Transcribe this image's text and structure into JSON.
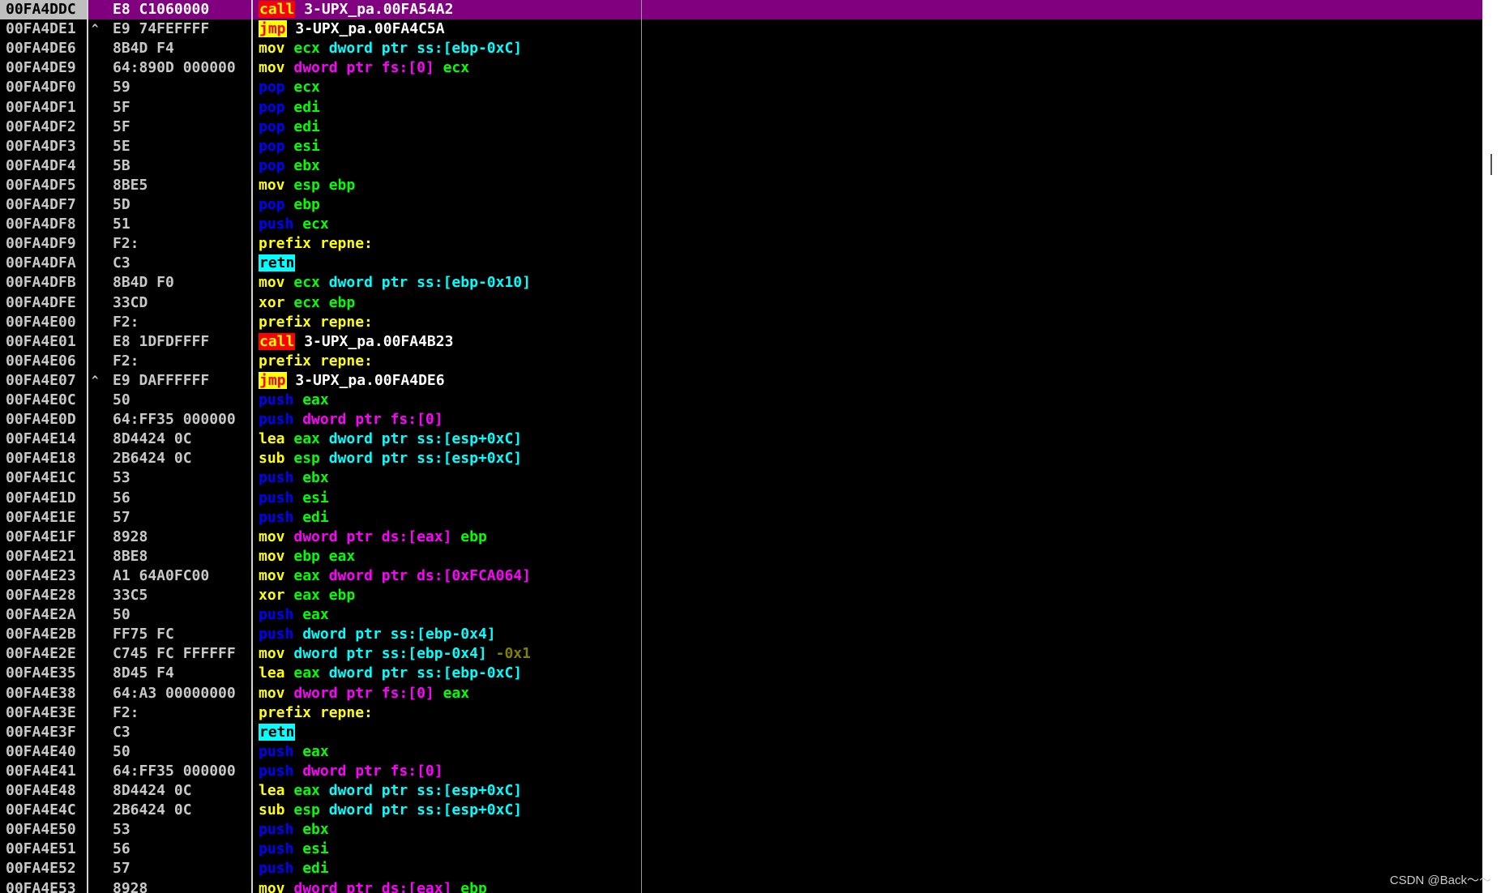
{
  "watermark": "CSDN @Back～～",
  "colors": {
    "selected_row": "#800080",
    "mnemonic": "#ffff00",
    "push_pop": "#0000ff",
    "register": "#00ff00",
    "memory_fs_ds": "#ff00ff",
    "stack_ss": "#00ffff",
    "negative_imm": "#808000",
    "call_highlight": "#ff0000",
    "jmp_highlight": "#ffff00",
    "retn_highlight": "#00ffff"
  },
  "rows": [
    {
      "addr": "00FA4DDC",
      "jmp": "",
      "hex": "E8 C1060000",
      "selected": true,
      "asm": [
        [
          "call",
          "call"
        ],
        [
          " ",
          ""
        ],
        [
          "3-UPX_pa.00FA54A2",
          "tgt"
        ]
      ]
    },
    {
      "addr": "00FA4DE1",
      "jmp": "^",
      "hex": "E9 74FEFFFF",
      "asm": [
        [
          "jmp",
          "jmp"
        ],
        [
          " ",
          ""
        ],
        [
          "3-UPX_pa.00FA4C5A",
          "tgt"
        ]
      ]
    },
    {
      "addr": "00FA4DE6",
      "jmp": "",
      "hex": "8B4D F4",
      "asm": [
        [
          "mov",
          "mn"
        ],
        [
          " ",
          ""
        ],
        [
          "ecx",
          "op"
        ],
        [
          ",",
          ""
        ],
        [
          "dword ptr ss:[ebp-0xC]",
          "ss"
        ]
      ]
    },
    {
      "addr": "00FA4DE9",
      "jmp": "",
      "hex": "64:890D 000000",
      "asm": [
        [
          "mov",
          "mn"
        ],
        [
          " ",
          ""
        ],
        [
          "dword ptr fs:[0]",
          "mem"
        ],
        [
          ",",
          ""
        ],
        [
          "ecx",
          "op"
        ]
      ]
    },
    {
      "addr": "00FA4DF0",
      "jmp": "",
      "hex": "59",
      "asm": [
        [
          "pop",
          "push"
        ],
        [
          " ",
          ""
        ],
        [
          "ecx",
          "op"
        ]
      ]
    },
    {
      "addr": "00FA4DF1",
      "jmp": "",
      "hex": "5F",
      "asm": [
        [
          "pop",
          "push"
        ],
        [
          " ",
          ""
        ],
        [
          "edi",
          "op"
        ]
      ]
    },
    {
      "addr": "00FA4DF2",
      "jmp": "",
      "hex": "5F",
      "asm": [
        [
          "pop",
          "push"
        ],
        [
          " ",
          ""
        ],
        [
          "edi",
          "op"
        ]
      ]
    },
    {
      "addr": "00FA4DF3",
      "jmp": "",
      "hex": "5E",
      "asm": [
        [
          "pop",
          "push"
        ],
        [
          " ",
          ""
        ],
        [
          "esi",
          "op"
        ]
      ]
    },
    {
      "addr": "00FA4DF4",
      "jmp": "",
      "hex": "5B",
      "asm": [
        [
          "pop",
          "push"
        ],
        [
          " ",
          ""
        ],
        [
          "ebx",
          "op"
        ]
      ]
    },
    {
      "addr": "00FA4DF5",
      "jmp": "",
      "hex": "8BE5",
      "asm": [
        [
          "mov",
          "mn"
        ],
        [
          " ",
          ""
        ],
        [
          "esp",
          "op"
        ],
        [
          ",",
          ""
        ],
        [
          "ebp",
          "op"
        ]
      ]
    },
    {
      "addr": "00FA4DF7",
      "jmp": "",
      "hex": "5D",
      "asm": [
        [
          "pop",
          "push"
        ],
        [
          " ",
          ""
        ],
        [
          "ebp",
          "op"
        ]
      ]
    },
    {
      "addr": "00FA4DF8",
      "jmp": "",
      "hex": "51",
      "asm": [
        [
          "push",
          "push"
        ],
        [
          " ",
          ""
        ],
        [
          "ecx",
          "op"
        ]
      ]
    },
    {
      "addr": "00FA4DF9",
      "jmp": "",
      "hex": "F2:",
      "asm": [
        [
          "prefix repne:",
          "mn"
        ]
      ]
    },
    {
      "addr": "00FA4DFA",
      "jmp": "",
      "hex": "C3",
      "asm": [
        [
          "retn",
          "retn"
        ]
      ]
    },
    {
      "addr": "00FA4DFB",
      "jmp": "",
      "hex": "8B4D F0",
      "asm": [
        [
          "mov",
          "mn"
        ],
        [
          " ",
          ""
        ],
        [
          "ecx",
          "op"
        ],
        [
          ",",
          ""
        ],
        [
          "dword ptr ss:[ebp-0x10]",
          "ss"
        ]
      ]
    },
    {
      "addr": "00FA4DFE",
      "jmp": "",
      "hex": "33CD",
      "asm": [
        [
          "xor",
          "mn"
        ],
        [
          " ",
          ""
        ],
        [
          "ecx",
          "op"
        ],
        [
          ",",
          ""
        ],
        [
          "ebp",
          "op"
        ]
      ]
    },
    {
      "addr": "00FA4E00",
      "jmp": "",
      "hex": "F2:",
      "asm": [
        [
          "prefix repne:",
          "mn"
        ]
      ]
    },
    {
      "addr": "00FA4E01",
      "jmp": "",
      "hex": "E8 1DFDFFFF",
      "asm": [
        [
          "call",
          "call"
        ],
        [
          " ",
          ""
        ],
        [
          "3-UPX_pa.00FA4B23",
          "tgt"
        ]
      ]
    },
    {
      "addr": "00FA4E06",
      "jmp": "",
      "hex": "F2:",
      "asm": [
        [
          "prefix repne:",
          "mn"
        ]
      ]
    },
    {
      "addr": "00FA4E07",
      "jmp": "^",
      "hex": "E9 DAFFFFFF",
      "asm": [
        [
          "jmp",
          "jmp"
        ],
        [
          " ",
          ""
        ],
        [
          "3-UPX_pa.00FA4DE6",
          "tgt"
        ]
      ]
    },
    {
      "addr": "00FA4E0C",
      "jmp": "",
      "hex": "50",
      "asm": [
        [
          "push",
          "push"
        ],
        [
          " ",
          ""
        ],
        [
          "eax",
          "op"
        ]
      ]
    },
    {
      "addr": "00FA4E0D",
      "jmp": "",
      "hex": "64:FF35 000000",
      "asm": [
        [
          "push",
          "push"
        ],
        [
          " ",
          ""
        ],
        [
          "dword ptr fs:[0]",
          "mem"
        ]
      ]
    },
    {
      "addr": "00FA4E14",
      "jmp": "",
      "hex": "8D4424 0C",
      "asm": [
        [
          "lea",
          "mn"
        ],
        [
          " ",
          ""
        ],
        [
          "eax",
          "op"
        ],
        [
          ",",
          ""
        ],
        [
          "dword ptr ss:[esp+0xC]",
          "ss"
        ]
      ]
    },
    {
      "addr": "00FA4E18",
      "jmp": "",
      "hex": "2B6424 0C",
      "asm": [
        [
          "sub",
          "mn"
        ],
        [
          " ",
          ""
        ],
        [
          "esp",
          "op"
        ],
        [
          ",",
          ""
        ],
        [
          "dword ptr ss:[esp+0xC]",
          "ss"
        ]
      ]
    },
    {
      "addr": "00FA4E1C",
      "jmp": "",
      "hex": "53",
      "asm": [
        [
          "push",
          "push"
        ],
        [
          " ",
          ""
        ],
        [
          "ebx",
          "op"
        ]
      ]
    },
    {
      "addr": "00FA4E1D",
      "jmp": "",
      "hex": "56",
      "asm": [
        [
          "push",
          "push"
        ],
        [
          " ",
          ""
        ],
        [
          "esi",
          "op"
        ]
      ]
    },
    {
      "addr": "00FA4E1E",
      "jmp": "",
      "hex": "57",
      "asm": [
        [
          "push",
          "push"
        ],
        [
          " ",
          ""
        ],
        [
          "edi",
          "op"
        ]
      ]
    },
    {
      "addr": "00FA4E1F",
      "jmp": "",
      "hex": "8928",
      "asm": [
        [
          "mov",
          "mn"
        ],
        [
          " ",
          ""
        ],
        [
          "dword ptr ds:[eax]",
          "mem"
        ],
        [
          ",",
          ""
        ],
        [
          "ebp",
          "op"
        ]
      ]
    },
    {
      "addr": "00FA4E21",
      "jmp": "",
      "hex": "8BE8",
      "asm": [
        [
          "mov",
          "mn"
        ],
        [
          " ",
          ""
        ],
        [
          "ebp",
          "op"
        ],
        [
          ",",
          ""
        ],
        [
          "eax",
          "op"
        ]
      ]
    },
    {
      "addr": "00FA4E23",
      "jmp": "",
      "hex": "A1 64A0FC00",
      "asm": [
        [
          "mov",
          "mn"
        ],
        [
          " ",
          ""
        ],
        [
          "eax",
          "op"
        ],
        [
          ",",
          ""
        ],
        [
          "dword ptr ds:[0xFCA064]",
          "mem"
        ]
      ]
    },
    {
      "addr": "00FA4E28",
      "jmp": "",
      "hex": "33C5",
      "asm": [
        [
          "xor",
          "mn"
        ],
        [
          " ",
          ""
        ],
        [
          "eax",
          "op"
        ],
        [
          ",",
          ""
        ],
        [
          "ebp",
          "op"
        ]
      ]
    },
    {
      "addr": "00FA4E2A",
      "jmp": "",
      "hex": "50",
      "asm": [
        [
          "push",
          "push"
        ],
        [
          " ",
          ""
        ],
        [
          "eax",
          "op"
        ]
      ]
    },
    {
      "addr": "00FA4E2B",
      "jmp": "",
      "hex": "FF75 FC",
      "asm": [
        [
          "push",
          "push"
        ],
        [
          " ",
          ""
        ],
        [
          "dword ptr ss:[ebp-0x4]",
          "ss"
        ]
      ]
    },
    {
      "addr": "00FA4E2E",
      "jmp": "",
      "hex": "C745 FC FFFFFF",
      "asm": [
        [
          "mov",
          "mn"
        ],
        [
          " ",
          ""
        ],
        [
          "dword ptr ss:[ebp-0x4]",
          "ss"
        ],
        [
          ",",
          ""
        ],
        [
          "-0x1",
          "num"
        ]
      ]
    },
    {
      "addr": "00FA4E35",
      "jmp": "",
      "hex": "8D45 F4",
      "asm": [
        [
          "lea",
          "mn"
        ],
        [
          " ",
          ""
        ],
        [
          "eax",
          "op"
        ],
        [
          ",",
          ""
        ],
        [
          "dword ptr ss:[ebp-0xC]",
          "ss"
        ]
      ]
    },
    {
      "addr": "00FA4E38",
      "jmp": "",
      "hex": "64:A3 00000000",
      "asm": [
        [
          "mov",
          "mn"
        ],
        [
          " ",
          ""
        ],
        [
          "dword ptr fs:[0]",
          "mem"
        ],
        [
          ",",
          ""
        ],
        [
          "eax",
          "op"
        ]
      ]
    },
    {
      "addr": "00FA4E3E",
      "jmp": "",
      "hex": "F2:",
      "asm": [
        [
          "prefix repne:",
          "mn"
        ]
      ]
    },
    {
      "addr": "00FA4E3F",
      "jmp": "",
      "hex": "C3",
      "asm": [
        [
          "retn",
          "retn"
        ]
      ]
    },
    {
      "addr": "00FA4E40",
      "jmp": "",
      "hex": "50",
      "asm": [
        [
          "push",
          "push"
        ],
        [
          " ",
          ""
        ],
        [
          "eax",
          "op"
        ]
      ]
    },
    {
      "addr": "00FA4E41",
      "jmp": "",
      "hex": "64:FF35 000000",
      "asm": [
        [
          "push",
          "push"
        ],
        [
          " ",
          ""
        ],
        [
          "dword ptr fs:[0]",
          "mem"
        ]
      ]
    },
    {
      "addr": "00FA4E48",
      "jmp": "",
      "hex": "8D4424 0C",
      "asm": [
        [
          "lea",
          "mn"
        ],
        [
          " ",
          ""
        ],
        [
          "eax",
          "op"
        ],
        [
          ",",
          ""
        ],
        [
          "dword ptr ss:[esp+0xC]",
          "ss"
        ]
      ]
    },
    {
      "addr": "00FA4E4C",
      "jmp": "",
      "hex": "2B6424 0C",
      "asm": [
        [
          "sub",
          "mn"
        ],
        [
          " ",
          ""
        ],
        [
          "esp",
          "op"
        ],
        [
          ",",
          ""
        ],
        [
          "dword ptr ss:[esp+0xC]",
          "ss"
        ]
      ]
    },
    {
      "addr": "00FA4E50",
      "jmp": "",
      "hex": "53",
      "asm": [
        [
          "push",
          "push"
        ],
        [
          " ",
          ""
        ],
        [
          "ebx",
          "op"
        ]
      ]
    },
    {
      "addr": "00FA4E51",
      "jmp": "",
      "hex": "56",
      "asm": [
        [
          "push",
          "push"
        ],
        [
          " ",
          ""
        ],
        [
          "esi",
          "op"
        ]
      ]
    },
    {
      "addr": "00FA4E52",
      "jmp": "",
      "hex": "57",
      "asm": [
        [
          "push",
          "push"
        ],
        [
          " ",
          ""
        ],
        [
          "edi",
          "op"
        ]
      ]
    },
    {
      "addr": "00FA4E53",
      "jmp": "",
      "hex": "8928",
      "asm": [
        [
          "mov",
          "mn"
        ],
        [
          " ",
          ""
        ],
        [
          "dword ptr ds:[eax]",
          "mem"
        ],
        [
          ",",
          ""
        ],
        [
          "ebp",
          "op"
        ]
      ]
    }
  ]
}
